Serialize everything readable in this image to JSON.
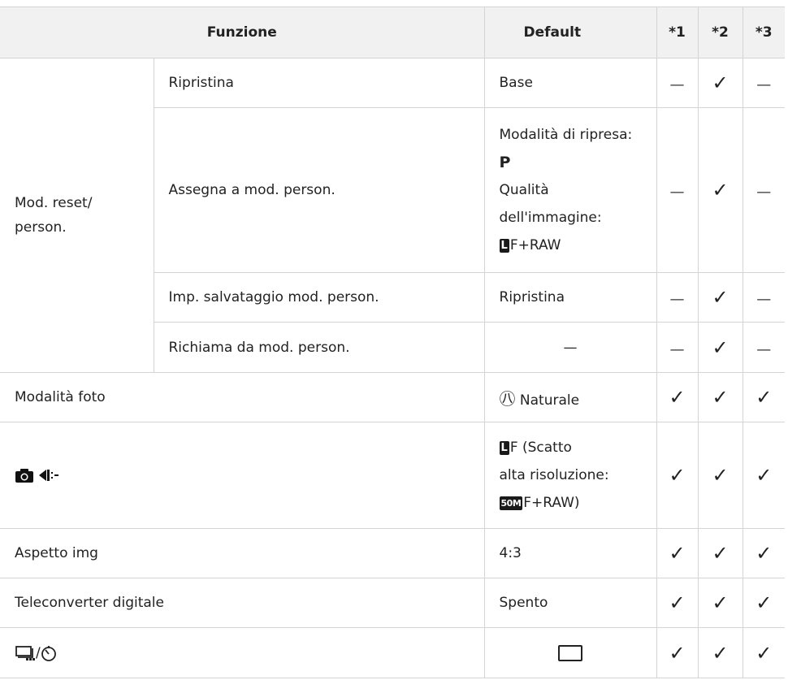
{
  "header": {
    "funzione": "Funzione",
    "default": "Default",
    "c1": "*1",
    "c2": "*2",
    "c3": "*3"
  },
  "rows": {
    "group_label": "Mod. reset/\nperson.",
    "ripristina": {
      "label": "Ripristina",
      "default": "Base"
    },
    "assegna": {
      "label": "Assegna a mod. person.",
      "d1": "Modalità di ripresa:",
      "d2": "P",
      "d3": "Qualità",
      "d4": "dell'immagine:",
      "d5_badge": "L",
      "d5_text": "F+RAW"
    },
    "imp": {
      "label": "Imp. salvataggio mod. person.",
      "default": "Ripristina"
    },
    "richiama": {
      "label": "Richiama da mod. person.",
      "default": "—"
    },
    "modalita_foto": {
      "label": "Modalità foto",
      "icon_text": "㊇",
      "default": "Naturale"
    },
    "camera": {
      "d1_badge": "L",
      "d1_text": "F (Scatto",
      "d2": "alta risoluzione:",
      "d3_badge": "50M",
      "d3_text": "F+RAW)"
    },
    "aspetto": {
      "label": "Aspetto img",
      "default": "4:3"
    },
    "teleconverter": {
      "label": "Teleconverter digitale",
      "default": "Spento"
    },
    "drive": {
      "label": "/"
    }
  },
  "marks": {
    "check": "✓",
    "dash": "—"
  }
}
